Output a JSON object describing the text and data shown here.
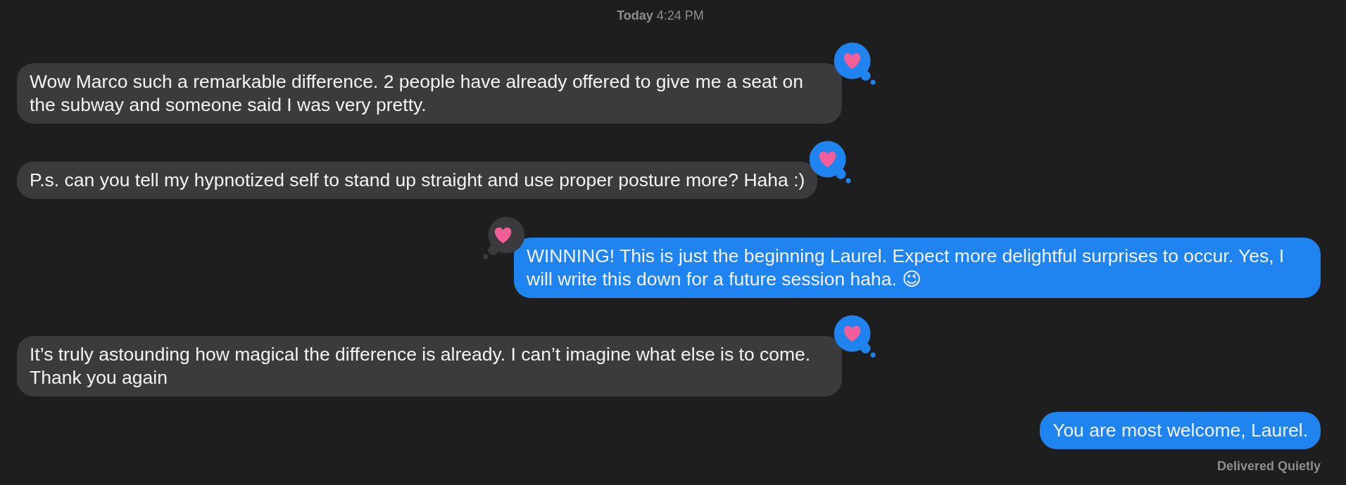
{
  "timestamp": {
    "day": "Today",
    "time": "4:24 PM"
  },
  "messages": [
    {
      "kind": "incoming",
      "text": "Wow Marco such a remarkable difference. 2 people have already offered to give me a seat on the subway and someone said I was very pretty.",
      "tapback": {
        "kind": "heart",
        "mine": true
      }
    },
    {
      "kind": "incoming",
      "text": "P.s. can you tell my hypnotized self to stand up straight and use proper posture more? Haha :)",
      "tapback": {
        "kind": "heart",
        "mine": true
      }
    },
    {
      "kind": "outgoing",
      "text": "WINNING! This is just the beginning Laurel. Expect more delightful surprises to occur. Yes, I will write this down for a future session haha. 😉",
      "tapback": {
        "kind": "heart",
        "mine": false
      }
    },
    {
      "kind": "incoming",
      "text": "It’s truly astounding how magical the difference is already. I can’t imagine what else is to come. Thank you again",
      "tapback": {
        "kind": "heart",
        "mine": true
      }
    },
    {
      "kind": "outgoing",
      "text": "You are most welcome, Laurel."
    }
  ],
  "status": "Delivered Quietly"
}
